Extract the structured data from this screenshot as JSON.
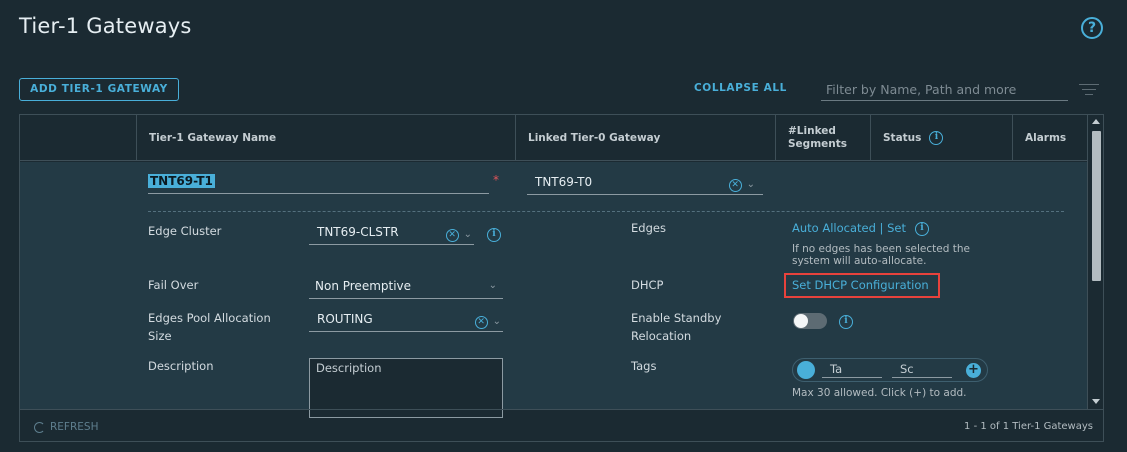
{
  "header": {
    "title": "Tier-1 Gateways",
    "help": "?"
  },
  "toolbar": {
    "add_label": "ADD TIER-1 GATEWAY",
    "collapse_label": "COLLAPSE ALL",
    "filter_placeholder": "Filter by Name, Path and more"
  },
  "columns": {
    "name": "Tier-1 Gateway Name",
    "linked_t0": "Linked Tier-0 Gateway",
    "linked_segments_1": "#Linked",
    "linked_segments_2": "Segments",
    "status": "Status",
    "alarms": "Alarms"
  },
  "row": {
    "name_value": "TNT69-T1",
    "t0_value": "TNT69-T0",
    "edge_cluster_label": "Edge Cluster",
    "edge_cluster_value": "TNT69-CLSTR",
    "failover_label": "Fail Over",
    "failover_value": "Non Preemptive",
    "pool_label_1": "Edges Pool Allocation",
    "pool_label_2": "Size",
    "pool_value": "ROUTING",
    "description_label": "Description",
    "description_placeholder": "Description",
    "edges_label": "Edges",
    "edges_link": "Auto Allocated | Set",
    "edges_hint_1": "If no edges has been selected the",
    "edges_hint_2": "system will auto-allocate.",
    "dhcp_label": "DHCP",
    "dhcp_link": "Set DHCP Configuration",
    "standby_label_1": "Enable Standby",
    "standby_label_2": "Relocation",
    "standby_on": false,
    "tags_label": "Tags",
    "tag_placeholder": "Ta",
    "scope_placeholder": "Sc",
    "tags_hint": "Max 30 allowed. Click (+) to add."
  },
  "footer": {
    "refresh_label": "REFRESH",
    "count": "1 - 1 of 1 Tier-1 Gateways"
  },
  "colors": {
    "accent": "#49afd9",
    "background": "#1b2a32",
    "highlight": "#e8423c"
  }
}
